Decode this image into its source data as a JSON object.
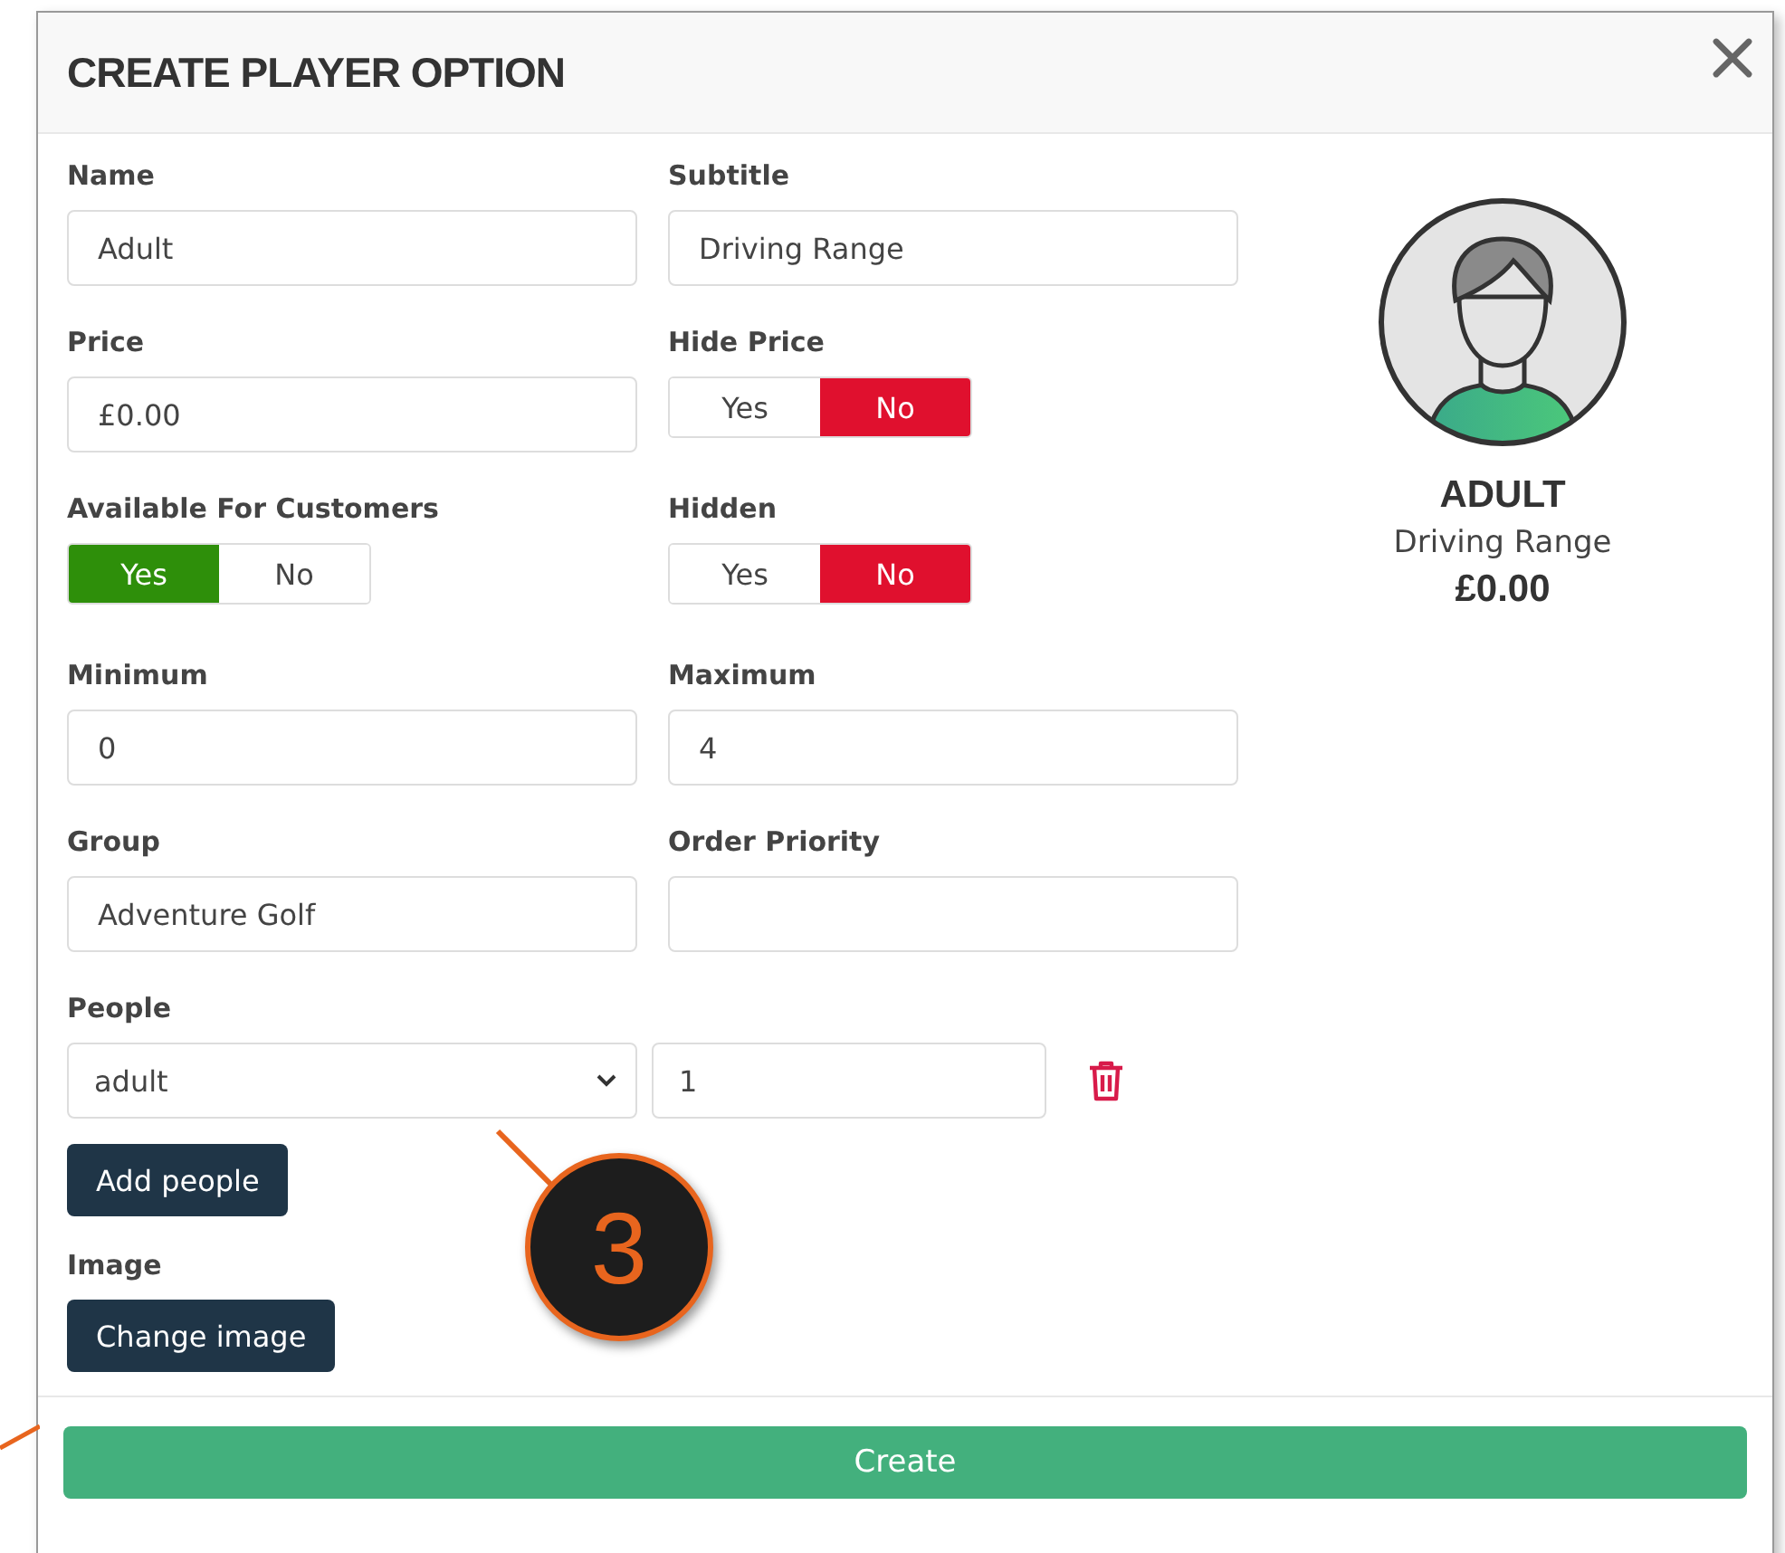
{
  "dialog": {
    "title": "CREATE PLAYER OPTION"
  },
  "rows": [
    [
      {
        "kind": "input",
        "label": "Name",
        "value": "Adult"
      },
      {
        "kind": "input",
        "label": "Subtitle",
        "value": "Driving Range"
      }
    ],
    [
      {
        "kind": "input",
        "label": "Price",
        "value": "£0.00"
      },
      {
        "kind": "toggle",
        "label": "Hide Price",
        "options": [
          {
            "label": "Yes",
            "selected": false
          },
          {
            "label": "No",
            "selected": true
          }
        ]
      }
    ],
    [
      {
        "kind": "toggle",
        "label": "Available For Customers",
        "options": [
          {
            "label": "Yes",
            "selected": true
          },
          {
            "label": "No",
            "selected": false
          }
        ]
      },
      {
        "kind": "toggle",
        "label": "Hidden",
        "options": [
          {
            "label": "Yes",
            "selected": false
          },
          {
            "label": "No",
            "selected": true
          }
        ]
      }
    ],
    [
      {
        "kind": "input",
        "label": "Minimum",
        "value": "0"
      },
      {
        "kind": "input",
        "label": "Maximum",
        "value": "4"
      }
    ],
    [
      {
        "kind": "input",
        "label": "Group",
        "value": "Adventure Golf"
      },
      {
        "kind": "input",
        "label": "Order Priority"
      }
    ]
  ],
  "people": {
    "label": "People",
    "rows": [
      {
        "type": "adult",
        "quantity": "1"
      }
    ],
    "add_button": "Add people"
  },
  "image": {
    "label": "Image",
    "button": "Change image"
  },
  "preview": {
    "name": "ADULT",
    "subtitle": "Driving Range",
    "price": "£0.00"
  },
  "create_button": "Create",
  "callout": {
    "number": "3"
  }
}
